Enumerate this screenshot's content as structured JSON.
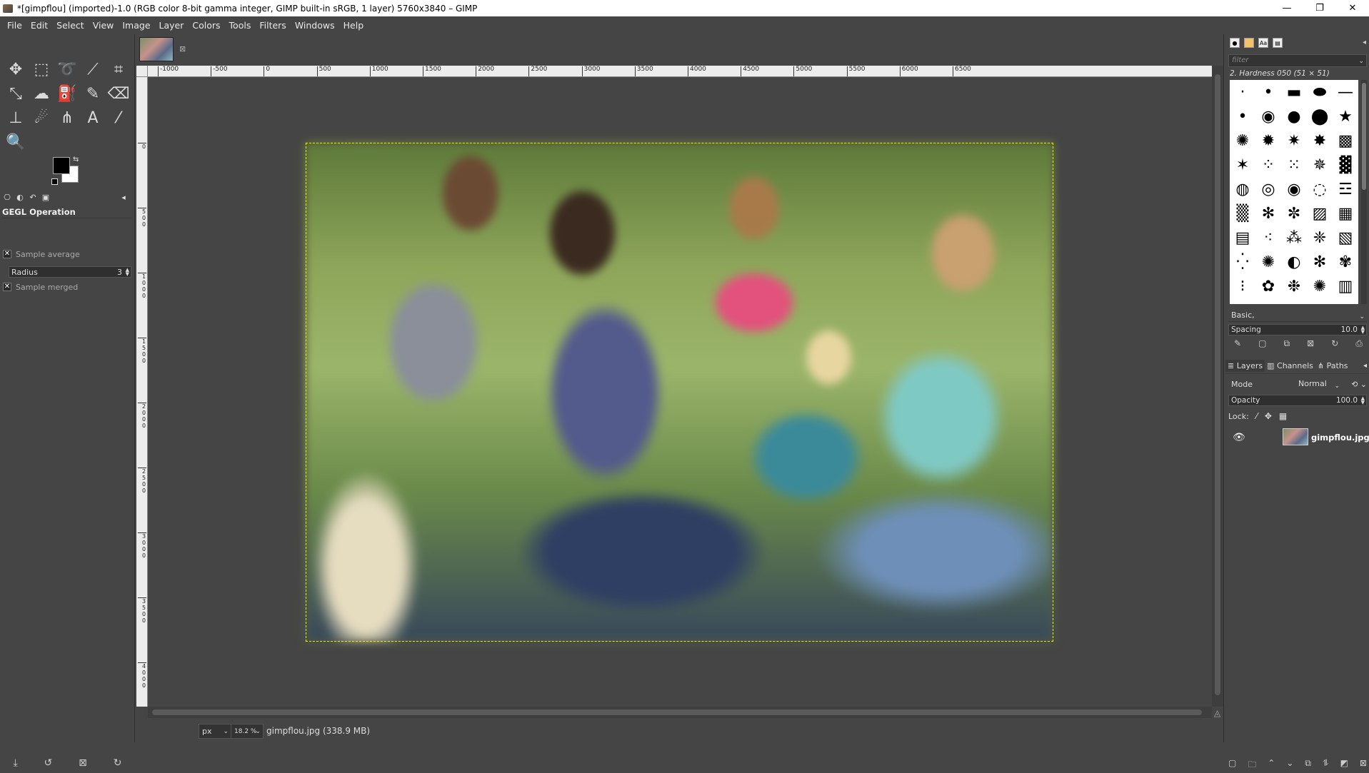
{
  "window": {
    "title": "*[gimpflou] (imported)-1.0 (RGB color 8-bit gamma integer, GIMP built-in sRGB, 1 layer) 5760x3840 – GIMP",
    "minimize": "—",
    "maximize": "❐",
    "close": "✕"
  },
  "menu": [
    "File",
    "Edit",
    "Select",
    "View",
    "Image",
    "Layer",
    "Colors",
    "Tools",
    "Filters",
    "Windows",
    "Help"
  ],
  "toolbox": {
    "tools": [
      {
        "name": "move-tool-icon",
        "glyph": "✥"
      },
      {
        "name": "rect-select-tool-icon",
        "glyph": "⬚"
      },
      {
        "name": "free-select-tool-icon",
        "glyph": "➰"
      },
      {
        "name": "fuzzy-select-tool-icon",
        "glyph": "⟋"
      },
      {
        "name": "crop-tool-icon",
        "glyph": "⌗"
      },
      {
        "name": "transform-tool-icon",
        "glyph": "⤡"
      },
      {
        "name": "warp-tool-icon",
        "glyph": "☁"
      },
      {
        "name": "bucket-fill-tool-icon",
        "glyph": "⛽"
      },
      {
        "name": "paintbrush-tool-icon",
        "glyph": "✎"
      },
      {
        "name": "eraser-tool-icon",
        "glyph": "⌫"
      },
      {
        "name": "clone-tool-icon",
        "glyph": "⊥"
      },
      {
        "name": "smudge-tool-icon",
        "glyph": "☄"
      },
      {
        "name": "paths-tool-icon",
        "glyph": "⋔"
      },
      {
        "name": "text-tool-icon",
        "glyph": "A"
      },
      {
        "name": "color-picker-tool-icon",
        "glyph": "⁄"
      },
      {
        "name": "zoom-tool-icon",
        "glyph": "🔍"
      }
    ],
    "options_title": "GEGL Operation",
    "sample_average_label": "Sample average",
    "radius_label": "Radius",
    "radius_value": "3",
    "sample_merged_label": "Sample merged",
    "check": "✕"
  },
  "ruler_h": [
    "-1000",
    "-500",
    "0",
    "500",
    "1000",
    "1500",
    "2000",
    "2500",
    "3000",
    "3500",
    "4000",
    "4500",
    "5000",
    "5500",
    "6000",
    "6500"
  ],
  "ruler_v": [
    "0",
    "500",
    "1000",
    "1500",
    "2000",
    "2500",
    "3000",
    "3500",
    "4000"
  ],
  "image_tab": {
    "close": "⊠"
  },
  "status": {
    "unit": "px",
    "zoom": "18.2 %",
    "text": "gimpflou.jpg (338.9 MB)"
  },
  "dock": {
    "filter_placeholder": "filter",
    "brush_name": "2. Hardness 050 (51 × 51)",
    "preset": "Basic,",
    "spacing_label": "Spacing",
    "spacing_value": "10.0",
    "tabs": {
      "layers": "Layers",
      "channels": "Channels",
      "paths": "Paths"
    },
    "mode_label": "Mode",
    "mode_value": "Normal",
    "opacity_label": "Opacity",
    "opacity_value": "100.0",
    "lock_label": "Lock:",
    "layer_name": "gimpflou.jpg"
  }
}
